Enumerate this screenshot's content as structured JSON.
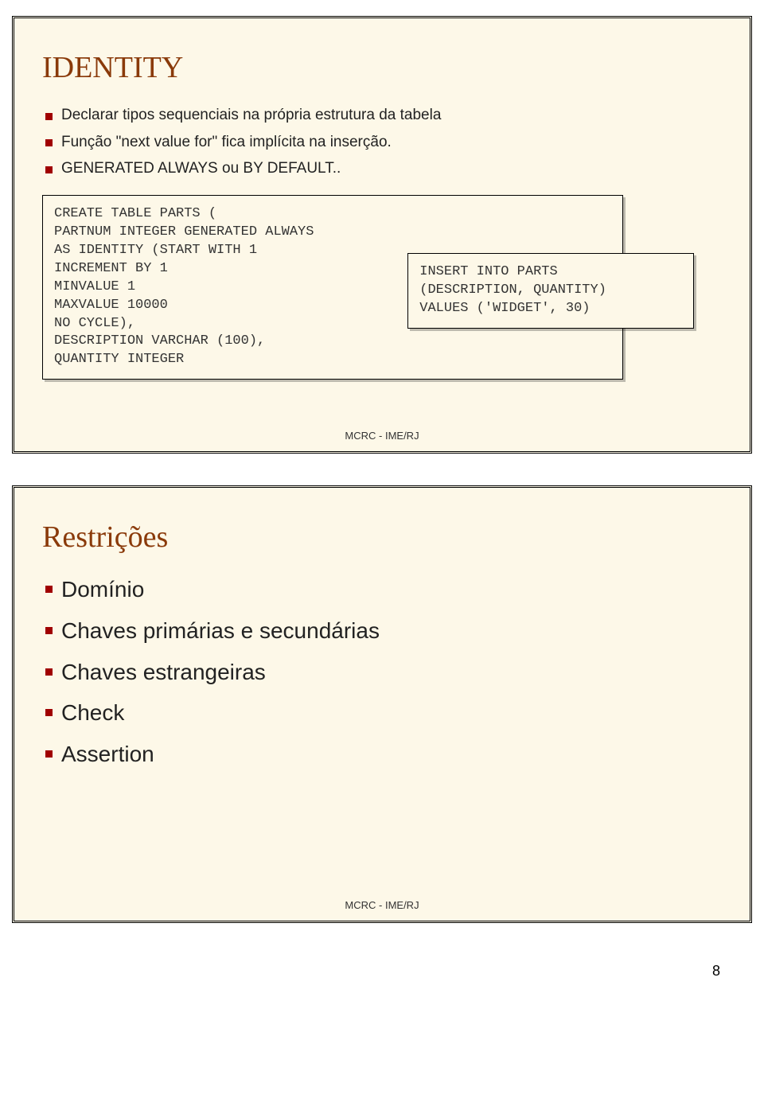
{
  "slide1": {
    "title": "IDENTITY",
    "bullets": [
      "Declarar tipos sequenciais na própria estrutura da tabela",
      "Função \"next value for\" fica implícita na inserção.",
      "GENERATED ALWAYS ou BY DEFAULT.."
    ],
    "code_outer": {
      "l1": "CREATE TABLE PARTS (",
      "l2": "PARTNUM INTEGER GENERATED ALWAYS",
      "l3": "AS IDENTITY (START WITH 1",
      "l4": "INCREMENT BY 1",
      "l5": "MINVALUE 1",
      "l6": "MAXVALUE 10000",
      "l7": "NO CYCLE),",
      "l8": "DESCRIPTION VARCHAR (100),",
      "l9": "QUANTITY INTEGER"
    },
    "code_inner": {
      "l1": "INSERT INTO PARTS",
      "l2": "(DESCRIPTION, QUANTITY)",
      "l3": "VALUES ('WIDGET', 30)"
    },
    "footer": "MCRC - IME/RJ"
  },
  "slide2": {
    "title": "Restrições",
    "bullets": [
      "Domínio",
      "Chaves primárias e secundárias",
      "Chaves estrangeiras",
      "Check",
      "Assertion"
    ],
    "footer": "MCRC - IME/RJ"
  },
  "page_number": "8"
}
